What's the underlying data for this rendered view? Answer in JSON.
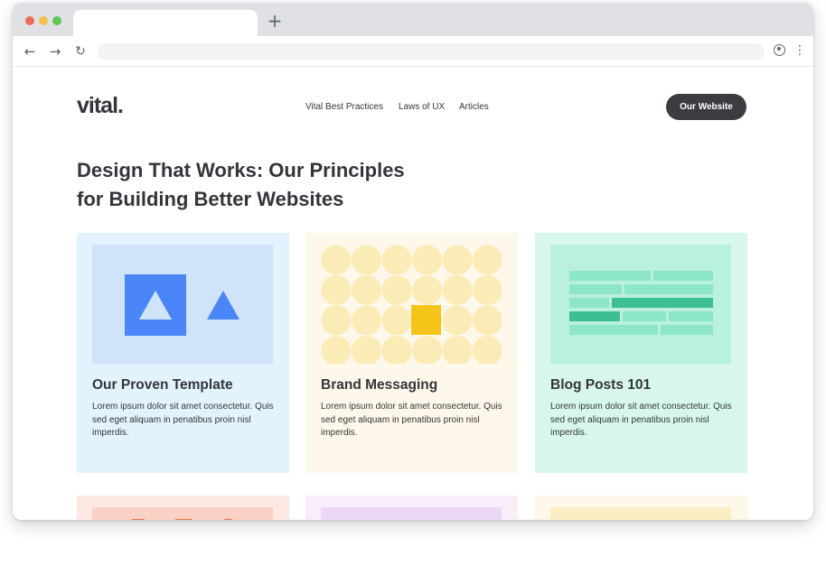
{
  "browser": {
    "new_tab_glyph": "+",
    "back_icon": "←",
    "forward_icon": "→",
    "reload_icon": "↻",
    "menu_icon": "⋮",
    "traffic_light_colors": [
      "#ed6a5e",
      "#f4bf4f",
      "#61c554"
    ]
  },
  "site": {
    "logo": "vital.",
    "nav": [
      "Vital Best Practices",
      "Laws of UX",
      "Articles"
    ],
    "cta_label": "Our Website",
    "headline_line1": "Design That Works: Our Principles",
    "headline_line2": "for Building Better Websites"
  },
  "cards": [
    {
      "title": "Our Proven Template",
      "body": "Lorem ipsum dolor sit amet consectetur. Quis sed eget aliquam in penatibus proin nisl imperdis.",
      "illustration": "square-and-triangles"
    },
    {
      "title": "Brand Messaging",
      "body": "Lorem ipsum dolor sit amet consectetur. Quis sed eget aliquam in penatibus proin nisl imperdis.",
      "illustration": "circle-grid-with-square"
    },
    {
      "title": "Blog Posts 101",
      "body": "Lorem ipsum dolor sit amet consectetur. Quis sed eget aliquam in penatibus proin nisl imperdis.",
      "illustration": "brick-wall"
    }
  ],
  "colors": {
    "text_dark": "#34353a",
    "cta_bg": "#3b3c40",
    "blue_accent": "#4a86f7",
    "yellow_accent": "#f4c518",
    "green_accent": "#3dbf91"
  }
}
